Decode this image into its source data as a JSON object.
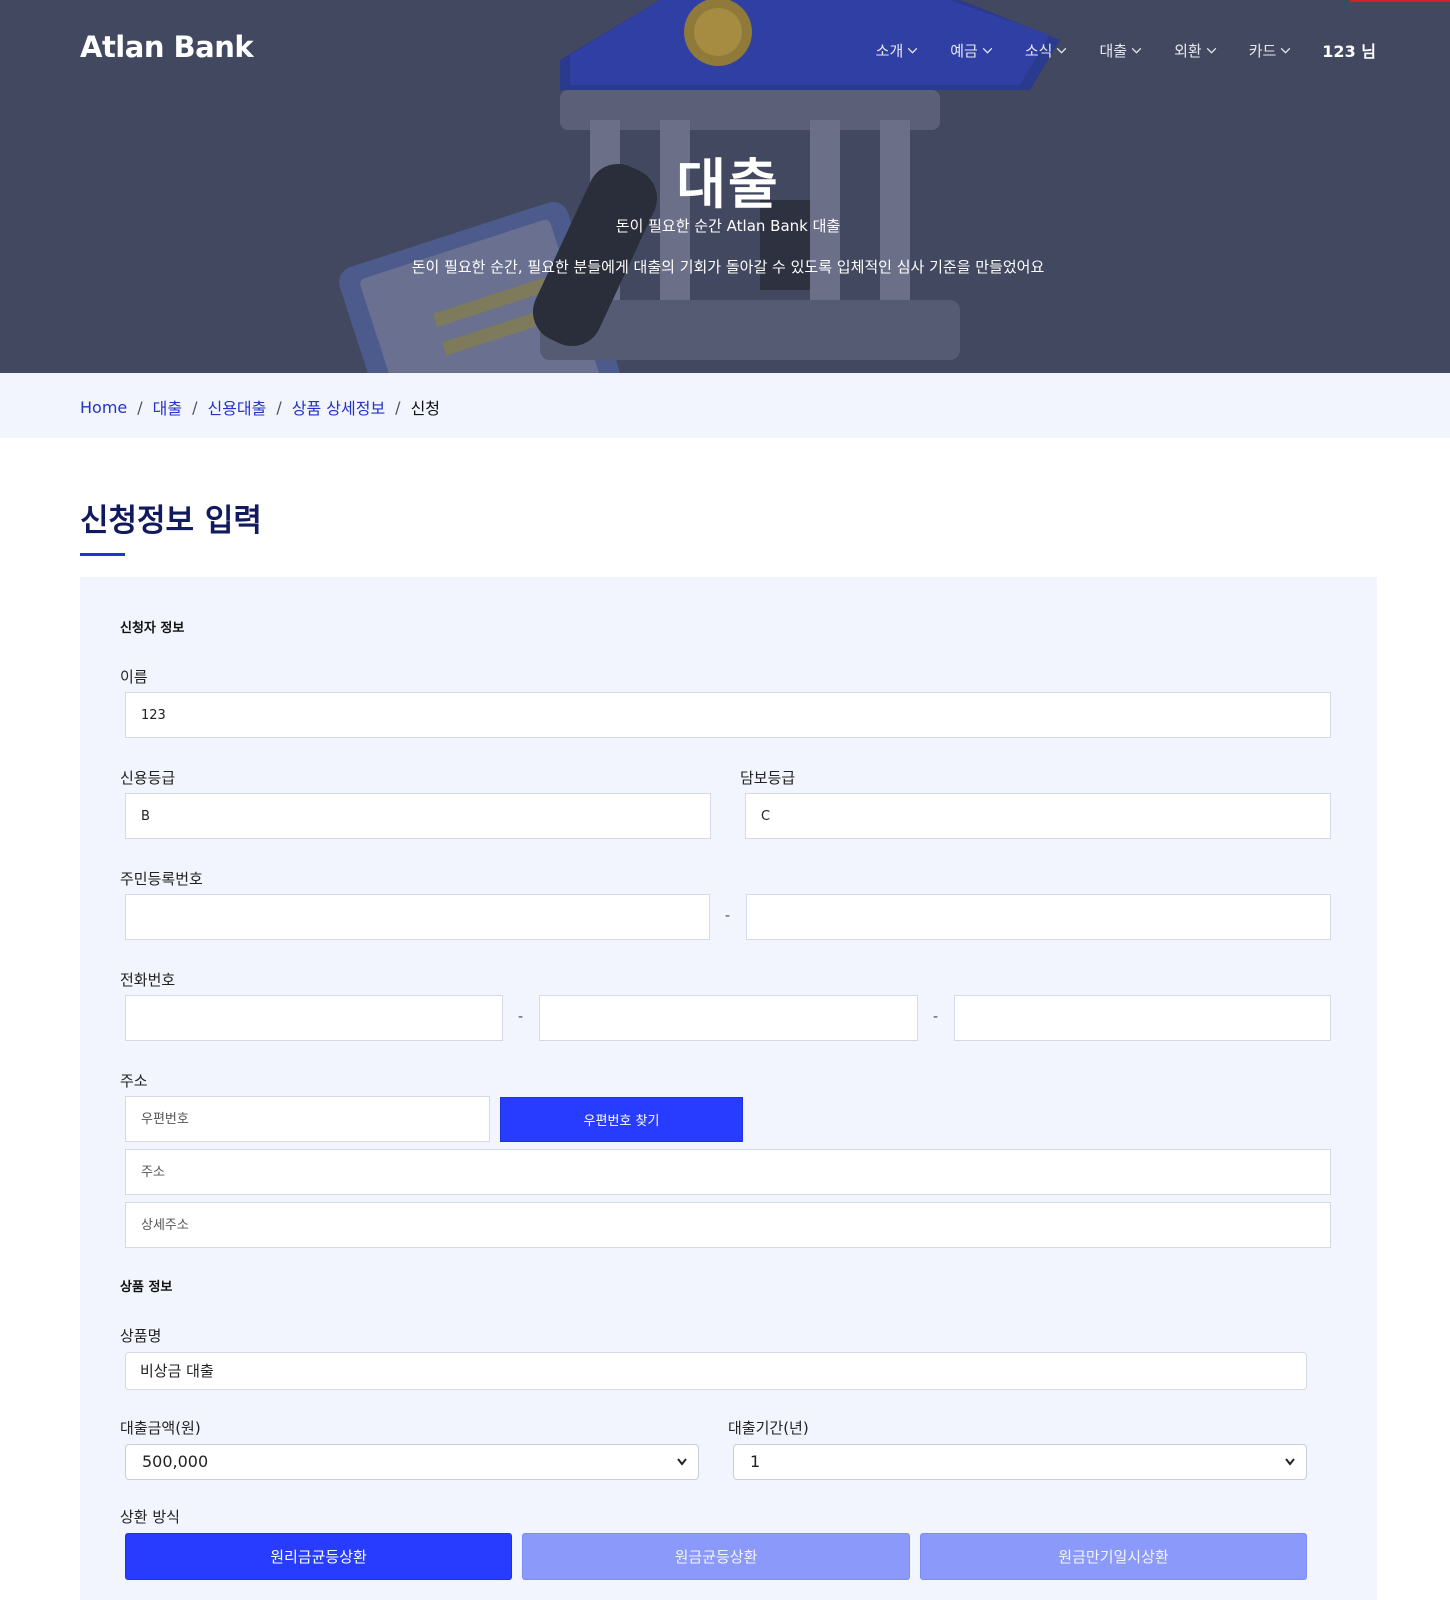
{
  "brand": {
    "name": "Atlan Bank"
  },
  "nav": {
    "items": [
      {
        "label": "소개"
      },
      {
        "label": "예금"
      },
      {
        "label": "소식"
      },
      {
        "label": "대출"
      },
      {
        "label": "외환"
      },
      {
        "label": "카드"
      }
    ],
    "user": "123 님"
  },
  "hero": {
    "title": "대출",
    "subtitle": "돈이 필요한 순간 Atlan Bank 대출",
    "description": "돈이 필요한 순간, 필요한 분들에게 대출의 기회가 돌아갈 수 있도록 입체적인 심사 기준을 만들었어요"
  },
  "breadcrumb": {
    "items": [
      "Home",
      "대출",
      "신용대출",
      "상품 상세정보"
    ],
    "current": "신청",
    "separator": "/"
  },
  "page_title": "신청정보 입력",
  "applicant": {
    "section_title": "신청자 정보",
    "name": {
      "label": "이름",
      "value": "123"
    },
    "credit_grade": {
      "label": "신용등급",
      "value": "B"
    },
    "collateral_grade": {
      "label": "담보등급",
      "value": "C"
    },
    "rrn": {
      "label": "주민등록번호",
      "separator": "-"
    },
    "phone": {
      "label": "전화번호",
      "separator": "-"
    },
    "address": {
      "label": "주소",
      "zip_placeholder": "우편번호",
      "zip_button": "우편번호 찾기",
      "address_placeholder": "주소",
      "detail_placeholder": "상세주소"
    }
  },
  "product": {
    "section_title": "상품 정보",
    "name": {
      "label": "상품명",
      "value": "비상금 대출"
    },
    "amount": {
      "label": "대출금액(원)",
      "value": "500,000"
    },
    "period": {
      "label": "대출기간(년)",
      "value": "1"
    },
    "repayment": {
      "label": "상환 방식",
      "options": [
        "원리금균등상환",
        "원금균등상환",
        "원금만기일시상환"
      ],
      "selected": "원리금균등상환"
    }
  },
  "colors": {
    "hero_bg": "#42485f",
    "accent": "#283cff",
    "accent_light": "#8b99fb",
    "panel_bg": "#f2f5fd",
    "title_navy": "#111a5e",
    "link_blue": "#2233c6"
  }
}
